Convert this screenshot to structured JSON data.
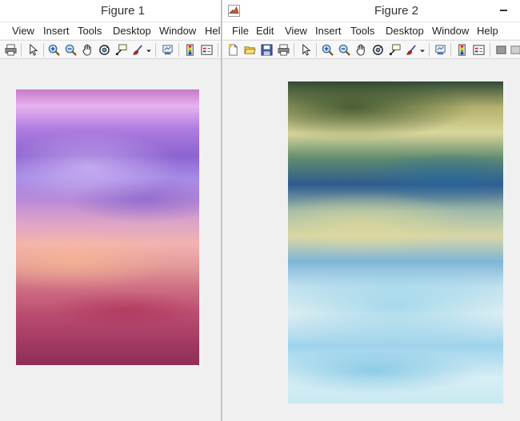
{
  "figure1": {
    "title": "Figure 1",
    "menu": [
      "View",
      "Insert",
      "Tools",
      "Desktop",
      "Window",
      "Help"
    ],
    "toolbar_icons": [
      "print-icon",
      "arrow-icon",
      "zoom-in-icon",
      "zoom-out-icon",
      "pan-icon",
      "rotate-icon",
      "datacursor-icon",
      "brush-icon",
      "link-icon",
      "colorbar-icon",
      "legend-icon"
    ]
  },
  "figure2": {
    "title": "Figure 2",
    "menu": [
      "File",
      "Edit",
      "View",
      "Insert",
      "Tools",
      "Desktop",
      "Window",
      "Help"
    ],
    "toolbar_icons": [
      "new-icon",
      "open-icon",
      "save-icon",
      "print-icon",
      "arrow-icon",
      "zoom-in-icon",
      "zoom-out-icon",
      "pan-icon",
      "rotate-icon",
      "datacursor-icon",
      "brush-icon",
      "link-icon",
      "colorbar-icon",
      "legend-icon",
      "hide-plot-tools-icon"
    ]
  },
  "colors": {
    "window_bg": "#f0f0f0",
    "titlebar_bg": "#ffffff",
    "toolbar_bg": "#f7f7f7"
  }
}
